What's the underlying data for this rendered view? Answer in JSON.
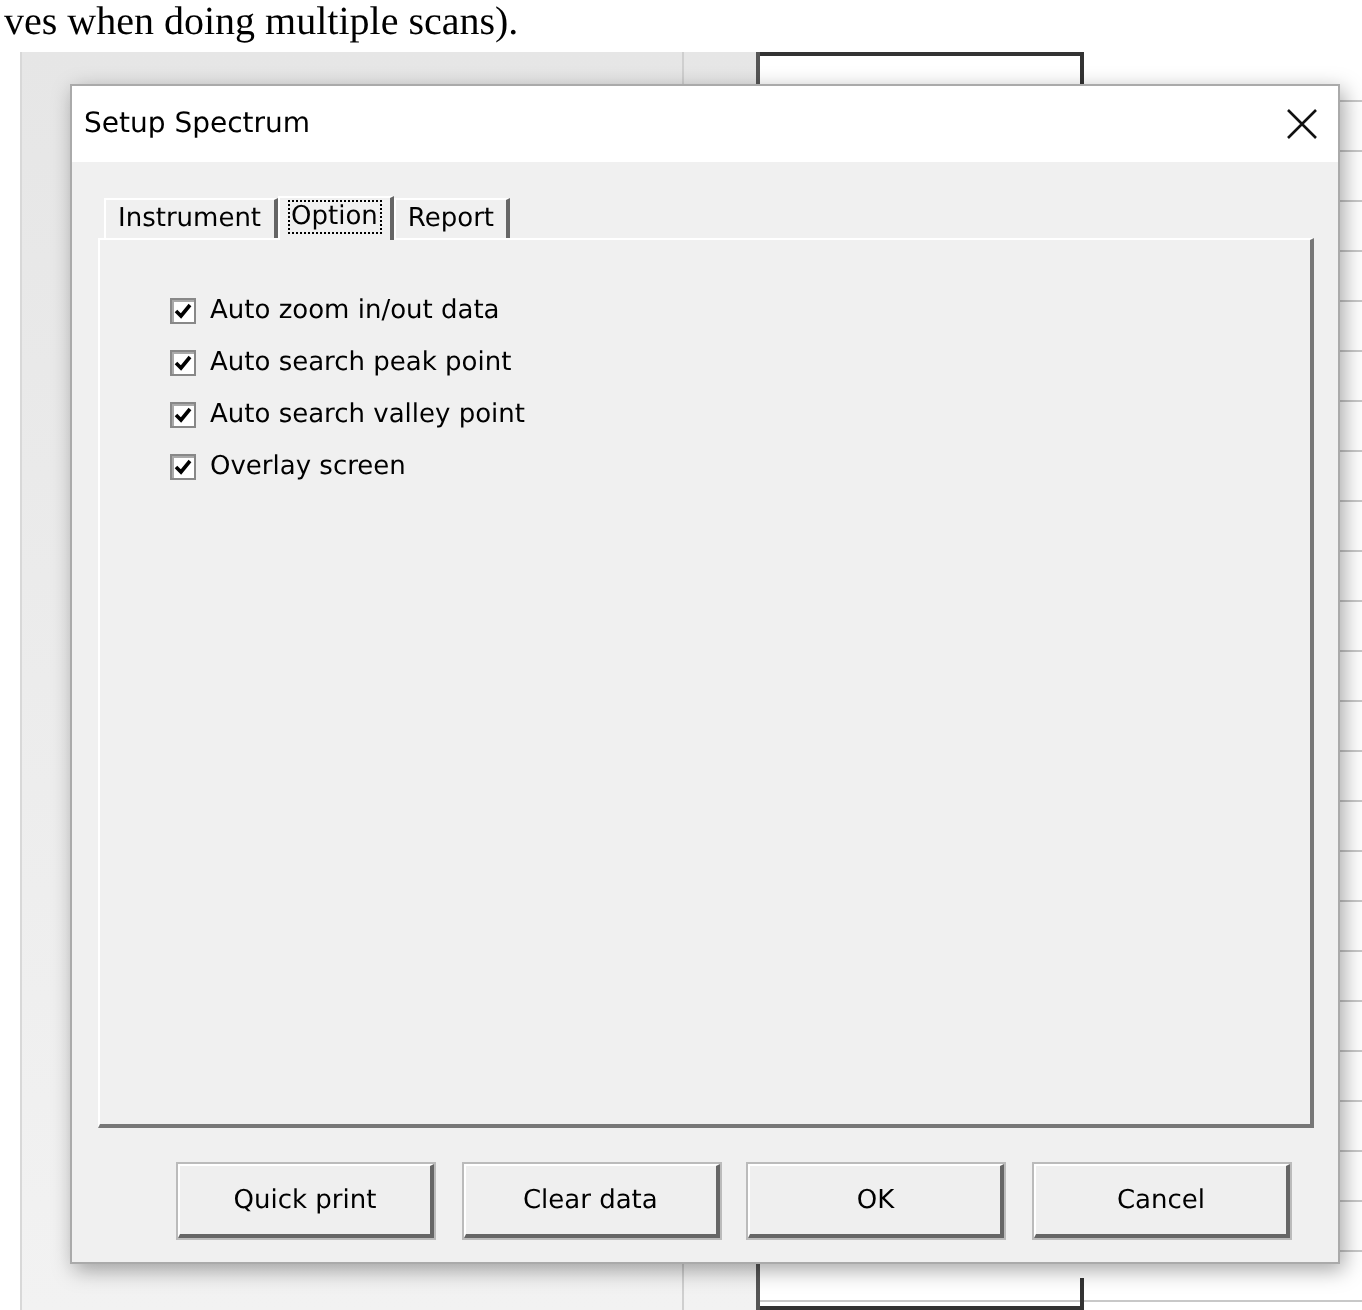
{
  "document_text": "ves when doing multiple scans).",
  "dialog": {
    "title": "Setup Spectrum",
    "tabs": [
      {
        "label": "Instrument",
        "selected": false
      },
      {
        "label": "Option",
        "selected": true
      },
      {
        "label": "Report",
        "selected": false
      }
    ],
    "options": [
      {
        "label": "Auto zoom in/out data",
        "checked": true
      },
      {
        "label": "Auto search peak point",
        "checked": true
      },
      {
        "label": "Auto search valley point",
        "checked": true
      },
      {
        "label": "Overlay screen",
        "checked": true
      }
    ],
    "buttons": [
      "Quick print",
      "Clear data",
      "OK",
      "Cancel"
    ]
  }
}
